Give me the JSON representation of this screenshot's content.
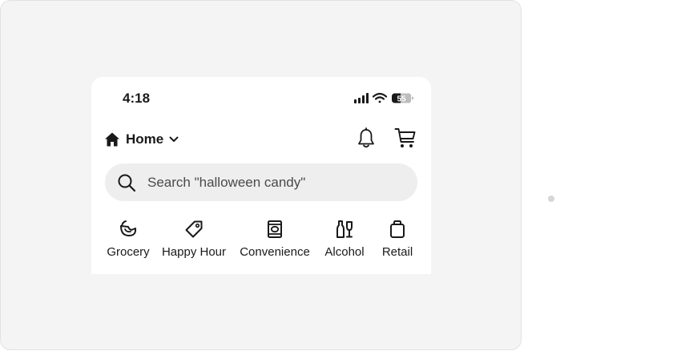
{
  "status_bar": {
    "time": "4:18",
    "battery": "55"
  },
  "header": {
    "location_label": "Home"
  },
  "search": {
    "placeholder": "Search \"halloween candy\""
  },
  "categories": [
    {
      "label": "Grocery",
      "icon": "grocery-icon"
    },
    {
      "label": "Happy Hour",
      "icon": "tag-icon"
    },
    {
      "label": "Convenience",
      "icon": "convenience-icon"
    },
    {
      "label": "Alcohol",
      "icon": "alcohol-icon"
    },
    {
      "label": "Retail",
      "icon": "shopping-bag-icon"
    }
  ],
  "colors": {
    "text": "#191919",
    "search_bg": "#eeeeee",
    "canvas_bg": "#f4f4f4"
  }
}
